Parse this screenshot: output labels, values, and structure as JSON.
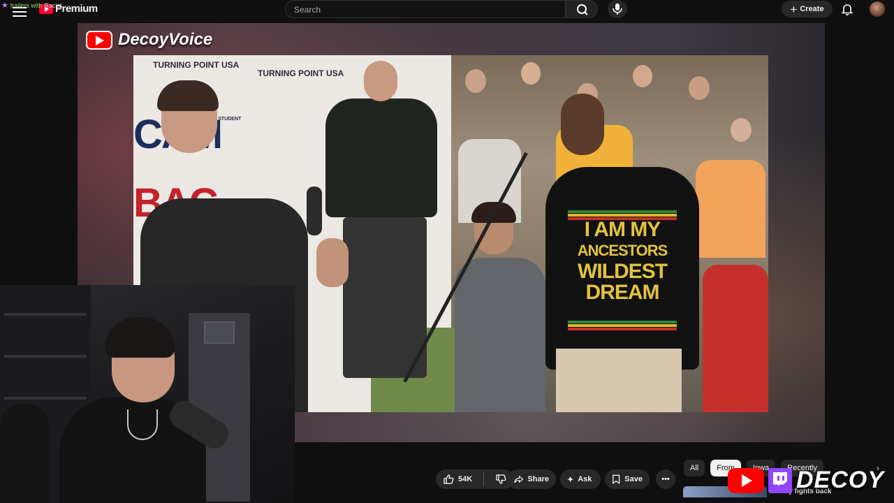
{
  "app": {
    "name": "YouTube",
    "logo_label": "Premium"
  },
  "overlay_chat": {
    "user": "trailers with",
    "message": "Racist"
  },
  "search": {
    "placeholder": "Search"
  },
  "header": {
    "create_label": "Create",
    "icons": [
      "menu-icon",
      "search-icon",
      "mic-icon",
      "plus-icon",
      "bell-icon",
      "avatar"
    ]
  },
  "video": {
    "channel_watermark": "DecoyVoice",
    "backdrop_text": {
      "brand_1": "TURNING POINT USA",
      "brand_2": "TURNING POINT USA",
      "private": "PRIVATE STUDENT",
      "headline_1": "CAM",
      "headline_2": "BAC"
    },
    "shirt_text": [
      "I AM MY",
      "ANCESTORS",
      "WILDEST",
      "DREAM"
    ],
    "stripe_colors": [
      "#2f8a3a",
      "#e0b92b",
      "#c6302c"
    ]
  },
  "actions": {
    "like_count": "54K",
    "share_label": "Share",
    "ask_label": "Ask",
    "save_label": "Save"
  },
  "chips": [
    {
      "label": "All",
      "active": false
    },
    {
      "label": "From",
      "active": true
    },
    {
      "label": "Iowa",
      "active": false
    },
    {
      "label": "Recently",
      "active": false
    }
  ],
  "recommendation": {
    "title": "finally fights back"
  },
  "stream_overlay": {
    "brand": "DECOY"
  },
  "colors": {
    "accent": "#ff0033",
    "twitch": "#9146ff",
    "background": "#0f0f0f",
    "chip": "#272727"
  }
}
